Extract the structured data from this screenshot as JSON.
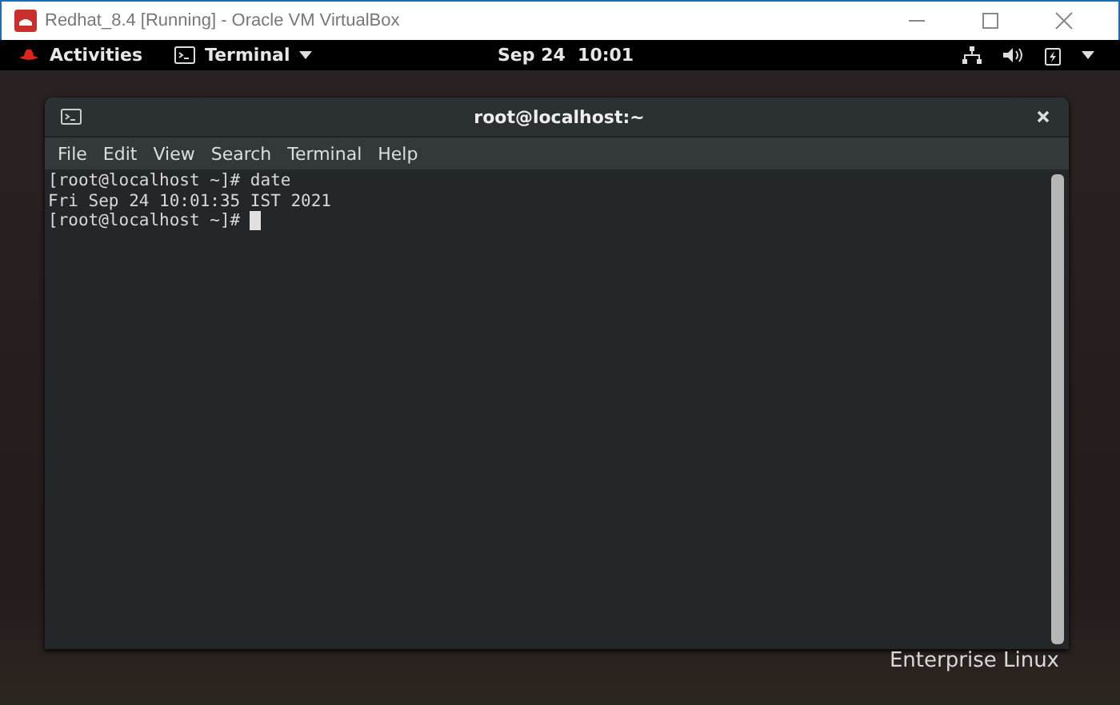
{
  "host_window": {
    "title": "Redhat_8.4 [Running] - Oracle VM VirtualBox"
  },
  "top_bar": {
    "activities": "Activities",
    "app_menu": "Terminal",
    "clock": "Sep 24  10:01"
  },
  "terminal": {
    "title": "root@localhost:~",
    "menu": [
      "File",
      "Edit",
      "View",
      "Search",
      "Terminal",
      "Help"
    ],
    "lines": [
      "[root@localhost ~]# date",
      "Fri Sep 24 10:01:35 IST 2021",
      "[root@localhost ~]# "
    ],
    "cursor": true
  },
  "branding": "Enterprise Linux"
}
